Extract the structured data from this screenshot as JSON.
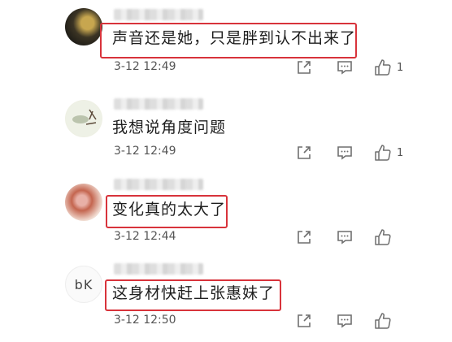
{
  "comments": [
    {
      "username": "",
      "text": "声音还是她，只是胖到认不出来了",
      "time": "3-12 12:49",
      "likes": "1",
      "highlighted": true
    },
    {
      "username": "",
      "text": "我想说角度问题",
      "time": "3-12 12:49",
      "likes": "1",
      "highlighted": false
    },
    {
      "username": "",
      "text": "变化真的太大了",
      "time": "3-12 12:44",
      "likes": "",
      "highlighted": true
    },
    {
      "username": "",
      "text": "这身材快赶上张惠妹了",
      "time": "3-12 12:50",
      "likes": "",
      "highlighted": true
    }
  ],
  "avatar4_text": "bK",
  "colors": {
    "highlight": "#d8333b",
    "meta": "#555555",
    "icon": "#6f6f6f"
  }
}
